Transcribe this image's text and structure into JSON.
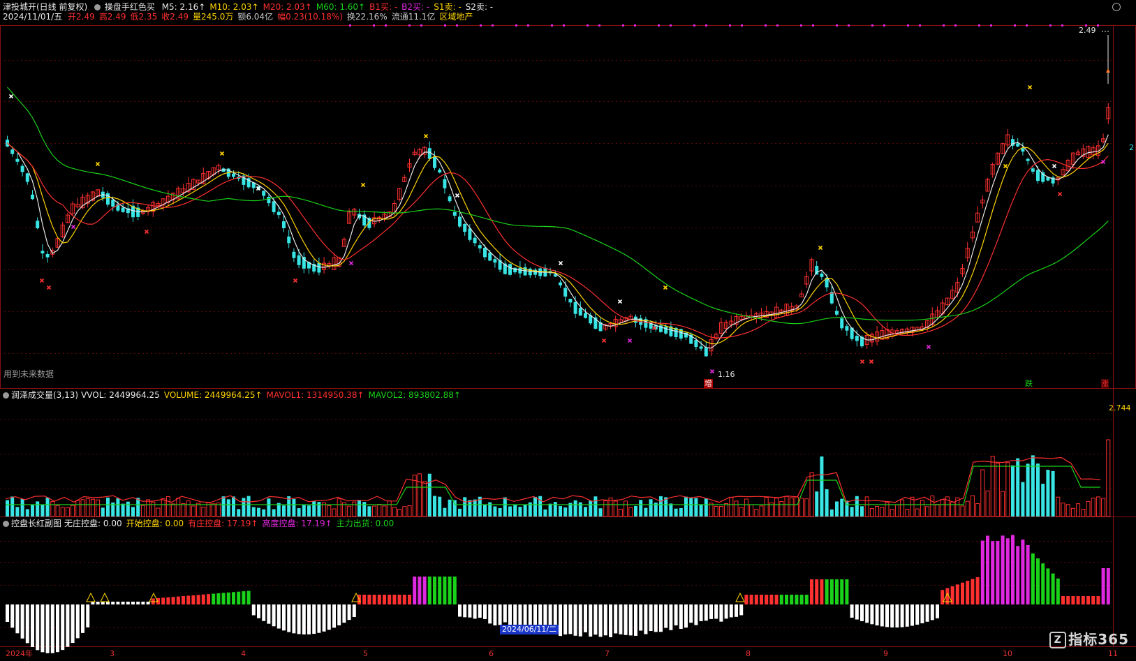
{
  "header": {
    "stock_name": "津投城开(日线 前复权)",
    "indicator_name": "操盘手红色买",
    "ma_values": [
      {
        "label": "M5: 2.16↑",
        "color": "#e8e8e8"
      },
      {
        "label": "M10: 2.03↑",
        "color": "#ffd400"
      },
      {
        "label": "M20: 2.03↑",
        "color": "#ff3030"
      },
      {
        "label": "M60: 1.60↑",
        "color": "#19d219"
      },
      {
        "label": "B1买: -",
        "color": "#ff3030"
      },
      {
        "label": "B2买: -",
        "color": "#e028e0"
      },
      {
        "label": "S1卖: -",
        "color": "#ffd400"
      },
      {
        "label": "S2卖: -",
        "color": "#e8e8e8"
      }
    ]
  },
  "quote": {
    "date": "2024/11/01/五",
    "items": [
      {
        "label": "开2.49",
        "color": "#ff3030"
      },
      {
        "label": "高2.49",
        "color": "#ff3030"
      },
      {
        "label": "低2.35",
        "color": "#ff3030"
      },
      {
        "label": "收2.49",
        "color": "#ff3030"
      },
      {
        "label": "量245.0万",
        "color": "#ffd400"
      },
      {
        "label": "额6.04亿",
        "color": "#c8c8c8"
      },
      {
        "label": "幅0.23(10.18%)",
        "color": "#ff3030"
      },
      {
        "label": "换22.16%",
        "color": "#c8c8c8"
      },
      {
        "label": "流通11.1亿",
        "color": "#c8c8c8"
      },
      {
        "label": "区域地产",
        "color": "#ffd400"
      }
    ]
  },
  "main_panel": {
    "future_data_note": "用到未来数据",
    "high_price_label": "2.49",
    "low_price_label": "1.16",
    "markers": {
      "increase": "增",
      "fall": "跌",
      "rise": "涨",
      "right_side": "2"
    }
  },
  "volume_panel": {
    "title": "润泽成交量(3,13)",
    "items": [
      {
        "label": "VVOL: 2449964.25",
        "color": "#e8e8e8"
      },
      {
        "label": "VOLUME: 2449964.25↑",
        "color": "#ffd400"
      },
      {
        "label": "MAVOL1: 1314950.38↑",
        "color": "#ff3030"
      },
      {
        "label": "MAVOL2: 893802.88↑",
        "color": "#19d219"
      }
    ],
    "max_label": "2.744"
  },
  "control_panel": {
    "title": "控盘长红副图",
    "items": [
      {
        "label": "无庄控盘: 0.00",
        "color": "#e8e8e8"
      },
      {
        "label": "开始控盘: 0.00",
        "color": "#ffd400"
      },
      {
        "label": "有庄控盘: 17.19↑",
        "color": "#ff3030"
      },
      {
        "label": "高度控盘: 17.19↑",
        "color": "#e028e0"
      },
      {
        "label": "主力出货: 0.00",
        "color": "#19d219"
      }
    ]
  },
  "x_axis": {
    "labels": [
      "2024年",
      "3",
      "4",
      "5",
      "6",
      "7",
      "8",
      "9",
      "10",
      "11"
    ],
    "highlighted_date": "2024/06/11/二"
  },
  "brand": {
    "logo_text": "指标365",
    "logo_mark": "Z"
  },
  "colors": {
    "up": "#ff3030",
    "down": "#38e4e4",
    "ma5": "#e8e8e8",
    "ma10": "#ffd400",
    "ma20": "#ff3030",
    "ma60": "#19d219",
    "pink": "#e028e0",
    "grid": "#8a1010"
  }
}
